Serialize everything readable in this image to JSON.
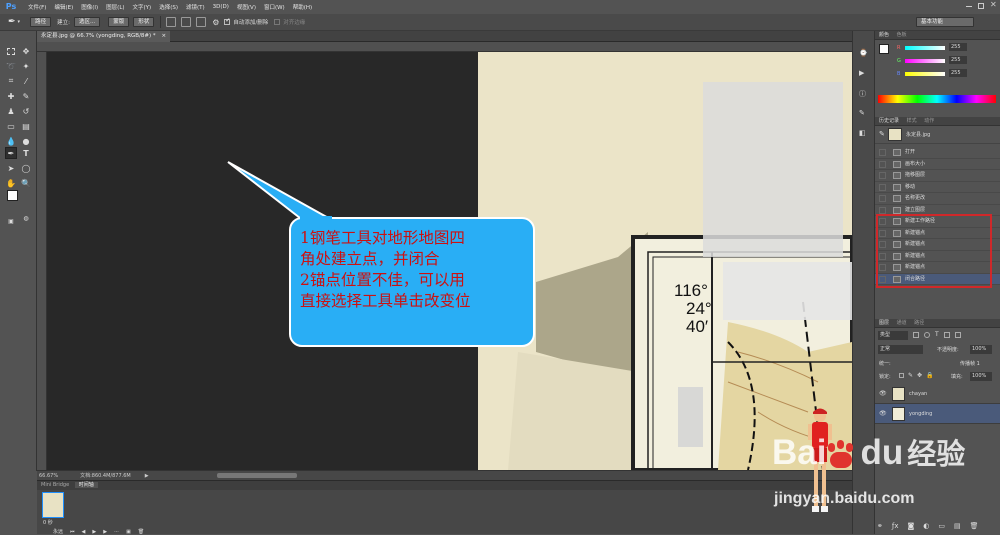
{
  "app": {
    "logo": "Ps"
  },
  "menu": [
    "文件(F)",
    "编辑(E)",
    "图像(I)",
    "图层(L)",
    "文字(Y)",
    "选择(S)",
    "滤镜(T)",
    "3D(D)",
    "视图(V)",
    "窗口(W)",
    "帮助(H)"
  ],
  "options": {
    "mode": "路径",
    "make_label": "建立:",
    "selection_btn": "选区...",
    "mask_btn": "蒙版",
    "shape_btn": "形状",
    "auto_add_delete": "自动添加/删除",
    "align_edges": "对齐边缘",
    "workspace": "基本功能"
  },
  "document": {
    "tab_title": "永定县.jpg @ 66.7% (yongding, RGB/8#) *"
  },
  "status": {
    "zoom": "66.67%",
    "doc_size": "文档:860.4M/877.6M"
  },
  "bridge": {
    "tab1": "Mini Bridge",
    "tab2": "时间轴",
    "frame_label": "0 秒",
    "loop_label": "永远"
  },
  "callout": {
    "lines": [
      "1钢笔工具对地形地图四",
      "角处建立点，并闭合",
      "2锚点位置不佳，可以用",
      "直接选择工具单击改变位"
    ]
  },
  "map_labels": {
    "coord1": "116°",
    "coord2": "24°",
    "coord3": "40′"
  },
  "color_panel": {
    "tab1": "颜色",
    "tab2": "色板",
    "r_label": "R",
    "g_label": "G",
    "b_label": "B",
    "r": "255",
    "g": "255",
    "b": "255"
  },
  "history_panel": {
    "tab1": "历史记录",
    "tab2": "样式",
    "tab3": "动作",
    "snapshot": "永定县.jpg",
    "items": [
      "打开",
      "画布大小",
      "拖移图层",
      "移动",
      "名称更改",
      "建立图层",
      "新建工作路径",
      "新建锚点",
      "新建锚点",
      "新建锚点",
      "新建锚点",
      "闭合路径"
    ]
  },
  "layers_panel": {
    "tab1": "图层",
    "tab2": "通道",
    "tab3": "路径",
    "kind": "类型",
    "blend": "正常",
    "opacity_label": "不透明度:",
    "opacity": "100%",
    "lock_label": "锁定:",
    "fill_label": "填充:",
    "fill": "100%",
    "unify_label": "统一:",
    "propagate_label": "传播帧 1",
    "layers": [
      {
        "name": "chayan",
        "selected": false
      },
      {
        "name": "yongding",
        "selected": true
      }
    ]
  },
  "watermark": {
    "brand": "Bai",
    "du": "du",
    "jingyan": "经验",
    "url": "jingyan.baidu.com"
  },
  "colors": {
    "accent_red": "#cc1111",
    "callout_blue": "#29aef5",
    "highlight_box": "#d0282a",
    "selected_row": "#4a5a7a"
  }
}
